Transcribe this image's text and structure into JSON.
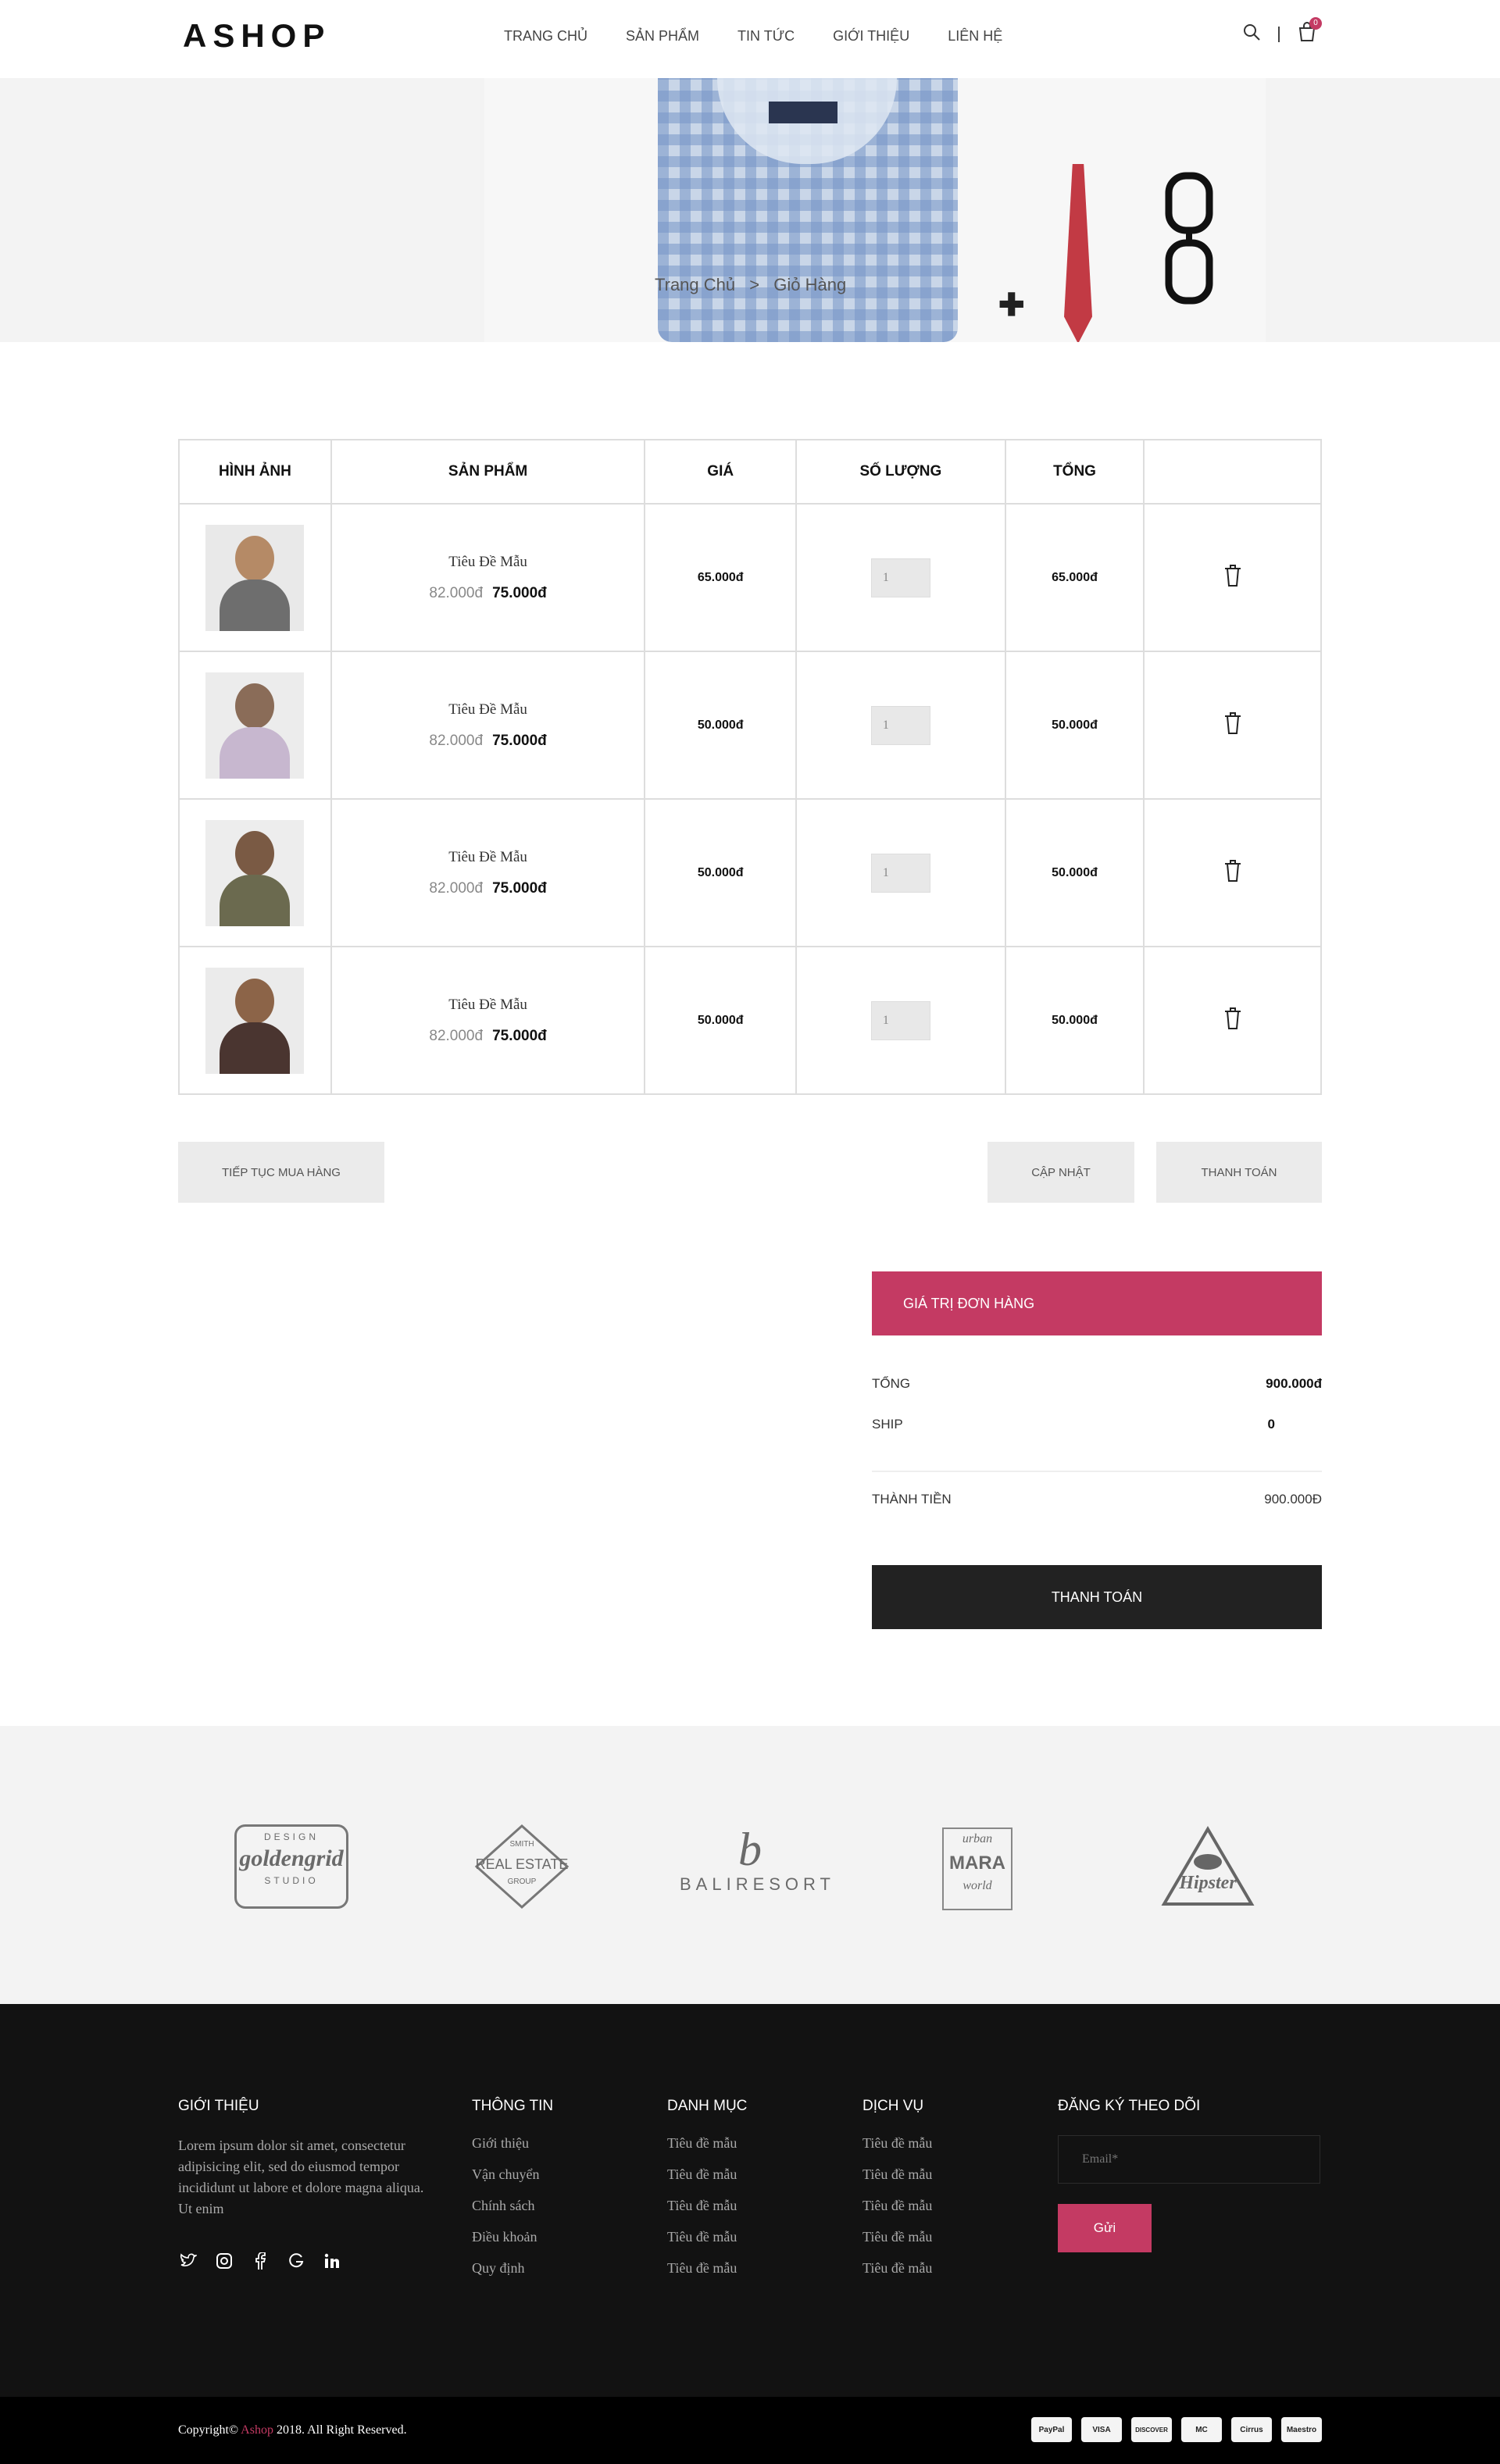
{
  "header": {
    "logo": "ASHOP",
    "nav": [
      "TRANG CHỦ",
      "SẢN PHẨM",
      "TIN TỨC",
      "GIỚI THIỆU",
      "LIÊN HỆ"
    ],
    "cart_count": "0",
    "icons": [
      "search-icon",
      "cart-icon"
    ]
  },
  "banner": {
    "breadcrumb_home": "Trang Chủ",
    "breadcrumb_sep": ">",
    "breadcrumb_current": "Giỏ Hàng"
  },
  "cart": {
    "headers": [
      "HÌNH ẢNH",
      "SẢN PHẨM",
      "GIÁ",
      "SỐ LƯỢNG",
      "TỔNG",
      ""
    ],
    "items": [
      {
        "title": "Tiêu Đề Mẫu",
        "old_price": "82.000đ",
        "new_price": "75.000đ",
        "price": "65.000đ",
        "qty": "1",
        "total": "65.000đ"
      },
      {
        "title": "Tiêu Đề Mẫu",
        "old_price": "82.000đ",
        "new_price": "75.000đ",
        "price": "50.000đ",
        "qty": "1",
        "total": "50.000đ"
      },
      {
        "title": "Tiêu Đề Mẫu",
        "old_price": "82.000đ",
        "new_price": "75.000đ",
        "price": "50.000đ",
        "qty": "1",
        "total": "50.000đ"
      },
      {
        "title": "Tiêu Đề Mẫu",
        "old_price": "82.000đ",
        "new_price": "75.000đ",
        "price": "50.000đ",
        "qty": "1",
        "total": "50.000đ"
      }
    ],
    "continue_label": "TIẾP TỤC MUA HÀNG",
    "update_label": "CẬP NHẬT",
    "checkout_label": "THANH TOÁN"
  },
  "summary": {
    "title": "GIÁ TRỊ ĐƠN HÀNG",
    "total_label": "TỔNG",
    "total_value": "900.000đ",
    "ship_label": "SHIP",
    "ship_value": "0",
    "grand_label": "THÀNH TIỀN",
    "grand_value": "900.000Đ",
    "pay_label": "THANH TOÁN"
  },
  "brands": {
    "b1_top": "DESIGN",
    "b1_mid": "goldengrid",
    "b1_bot": "STUDIO",
    "b2_top": "SMITH",
    "b2_mid": "REAL ESTATE",
    "b2_bot": "GROUP",
    "b3_mark": "b",
    "b3_name": "BALIRESORT",
    "b4_top": "urban",
    "b4_mid": "MARA",
    "b4_bot": "world",
    "b5_mid": "Hipster"
  },
  "footer": {
    "about_title": "GIỚI THIỆU",
    "about_text": "Lorem ipsum dolor sit amet, consectetur adipisicing elit, sed do eiusmod tempor incididunt ut labore et dolore magna aliqua. Ut enim",
    "info_title": "THÔNG TIN",
    "info_links": [
      "Giới thiệu",
      "Vận chuyển",
      "Chính sách",
      "Điều khoản",
      "Quy định"
    ],
    "cat_title": "DANH MỤC",
    "cat_links": [
      "Tiêu đề mẫu",
      "Tiêu đề mẫu",
      "Tiêu đề mẫu",
      "Tiêu đề mẫu",
      "Tiêu đề mẫu"
    ],
    "svc_title": "DỊCH VỤ",
    "svc_links": [
      "Tiêu đề mẫu",
      "Tiêu đề mẫu",
      "Tiêu đề mẫu",
      "Tiêu đề mẫu",
      "Tiêu đề mẫu"
    ],
    "sub_title": "ĐĂNG KÝ THEO DÕI",
    "email_placeholder": "Email*",
    "send_label": "Gửi",
    "socials": [
      "twitter-icon",
      "instagram-icon",
      "facebook-icon",
      "google-icon",
      "linkedin-icon"
    ]
  },
  "bottom": {
    "copy_prefix": "Copyright©",
    "copy_brand": "Ashop",
    "copy_suffix": "2018. All Right Reserved.",
    "cards": [
      "PayPal",
      "VISA",
      "DISCOVER",
      "MC",
      "Cirrus",
      "Maestro"
    ]
  },
  "colors": {
    "accent": "#c43a63",
    "dark": "#222222",
    "footer_bg": "#121212"
  }
}
